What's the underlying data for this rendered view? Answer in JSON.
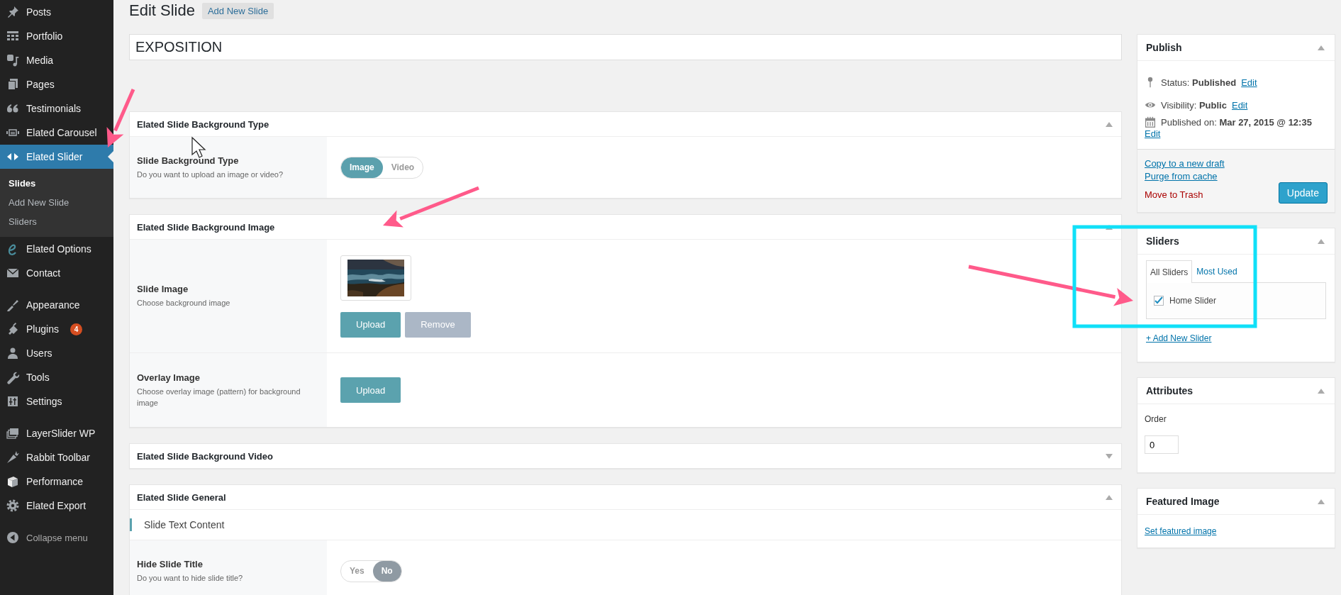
{
  "sidebar": {
    "groups": [
      [
        {
          "label": "Posts",
          "selected": false
        },
        {
          "label": "Portfolio",
          "selected": false
        },
        {
          "label": "Media",
          "selected": false
        },
        {
          "label": "Pages",
          "selected": false
        },
        {
          "label": "Testimonials",
          "selected": false
        },
        {
          "label": "Elated Carousel",
          "selected": false
        },
        {
          "label": "Elated Slider",
          "selected": true,
          "children": [
            {
              "label": "Slides",
              "selected": true
            },
            {
              "label": "Add New Slide",
              "selected": false
            },
            {
              "label": "Sliders",
              "selected": false
            }
          ]
        },
        {
          "label": "Elated Options",
          "selected": false
        },
        {
          "label": "Contact",
          "selected": false
        }
      ],
      [
        {
          "label": "Appearance",
          "selected": false
        },
        {
          "label": "Plugins",
          "selected": false,
          "badge": "4"
        },
        {
          "label": "Users",
          "selected": false
        },
        {
          "label": "Tools",
          "selected": false
        },
        {
          "label": "Settings",
          "selected": false
        }
      ],
      [
        {
          "label": "LayerSlider WP",
          "selected": false
        },
        {
          "label": "Rabbit Toolbar",
          "selected": false
        },
        {
          "label": "Performance",
          "selected": false
        },
        {
          "label": "Elated Export",
          "selected": false
        }
      ]
    ],
    "collapse_label": "Collapse menu"
  },
  "page_title": "Edit Slide",
  "add_new_button": "Add New Slide",
  "title_field": {
    "value": "EXPOSITION"
  },
  "meta_boxes": [
    {
      "title": "Elated Slide Background Type",
      "expanded": true,
      "rows": [
        {
          "kind": "toggle",
          "label": "Slide Background Type",
          "description": "Do you want to upload an image or video?",
          "options": [
            {
              "label": "Image",
              "selected": true
            },
            {
              "label": "Video",
              "selected": false
            }
          ]
        }
      ]
    },
    {
      "title": "Elated Slide Background Image",
      "expanded": true,
      "rows": [
        {
          "label": "Slide Image",
          "description": "Choose background image",
          "image": {
            "kind": "picture"
          },
          "buttons": [
            {
              "label": "Upload",
              "kind": "primary"
            },
            {
              "label": "Remove",
              "kind": "secondary"
            }
          ]
        },
        {
          "label": "Overlay Image",
          "description": "Choose overlay image (pattern) for background image",
          "buttons": [
            {
              "label": "Upload",
              "kind": "primary"
            }
          ]
        }
      ]
    },
    {
      "title": "Elated Slide Background Video",
      "expanded": false
    },
    {
      "title": "Elated Slide General",
      "expanded": true,
      "rows": [
        {
          "kind": "heading",
          "label": "Slide Text Content"
        },
        {
          "kind": "toggle",
          "label": "Hide Slide Title",
          "description": "Do you want to hide slide title?",
          "options": [
            {
              "label": "Yes",
              "selected": false
            },
            {
              "label": "No",
              "selected": true
            }
          ]
        }
      ]
    }
  ],
  "publish": {
    "title": "Publish",
    "expanded": true,
    "fields": [
      {
        "kind": "status",
        "label": "Status:",
        "value": "Published",
        "link": "Edit"
      },
      {
        "kind": "visibility",
        "label": "Visibility:",
        "value": "Public",
        "link": "Edit"
      },
      {
        "kind": "date",
        "label": "Published on:",
        "value": "Mar 27, 2015 @ 12:35",
        "link": "Edit"
      }
    ],
    "links": [
      "Copy to a new draft",
      "Purge from cache"
    ],
    "trash": "Move to Trash",
    "update_button": "Update"
  },
  "sliders_box": {
    "title": "Sliders",
    "expanded": true,
    "tabs": [
      {
        "label": "All Sliders",
        "selected": true
      },
      {
        "label": "Most Used",
        "selected": false
      }
    ],
    "items": [
      {
        "label": "Home Slider",
        "checked": true
      }
    ],
    "add_link": "+ Add New Slider"
  },
  "attributes": {
    "title": "Attributes",
    "expanded": true,
    "order_label": "Order",
    "order_value": "0"
  },
  "featured_image": {
    "title": "Featured Image",
    "expanded": true,
    "link": "Set featured image"
  }
}
